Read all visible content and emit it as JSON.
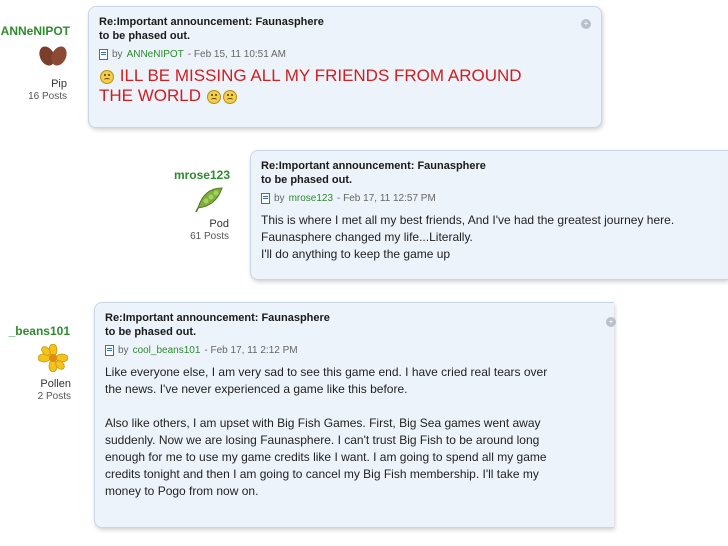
{
  "posts": [
    {
      "username": "ANNeNIPOT",
      "rank": "Pip",
      "post_count": "16 Posts",
      "title_line1": "Re:Important announcement: Faunasphere",
      "title_line2": "to be phased out.",
      "by": "by",
      "author_link": "ANNeNIPOT",
      "date": "- Feb 15, 11 10:51 AM",
      "message_line1": "ILL BE MISSING ALL MY FRIENDS FROM AROUND",
      "message_line2": "THE WORLD",
      "avatar_icon": "bean-pip-icon"
    },
    {
      "username": "mrose123",
      "rank": "Pod",
      "post_count": "61 Posts",
      "title_line1": "Re:Important announcement: Faunasphere",
      "title_line2": "to be phased out.",
      "by": "by",
      "author_link": "mrose123",
      "date": "- Feb 17, 11 12:57 PM",
      "message_lines": [
        "This is where I met all my best friends, And I've had the greatest journey here.",
        "Faunasphere changed my life...Literally.",
        "I'll do anything to keep the game up"
      ],
      "avatar_icon": "pea-pod-icon"
    },
    {
      "username": "_beans101",
      "rank": "Pollen",
      "post_count": "2 Posts",
      "title_line1": "Re:Important announcement: Faunasphere",
      "title_line2": "to be phased out.",
      "by": "by",
      "author_link": "cool_beans101",
      "date": "- Feb 17, 11 2:12 PM",
      "paragraph1": [
        "Like everyone else, I am very sad to see this game end. I have cried real tears over",
        "the news. I've never experienced a game like this before."
      ],
      "paragraph2": [
        "Also like others, I am upset with Big Fish Games. First, Big Sea games went away",
        "suddenly. Now we are losing Faunasphere. I can't trust Big Fish to be around long",
        "enough for me to use my game credits like I want. I am going to spend all my game",
        "credits tonight and then I am going to cancel my Big Fish membership. I'll take my",
        "money to Pogo from now on."
      ],
      "avatar_icon": "pollen-flower-icon"
    }
  ],
  "colors": {
    "username_green": "#2e8b2e",
    "shout_red": "#d11e1e",
    "bubble_bg": "#edf3fb"
  }
}
